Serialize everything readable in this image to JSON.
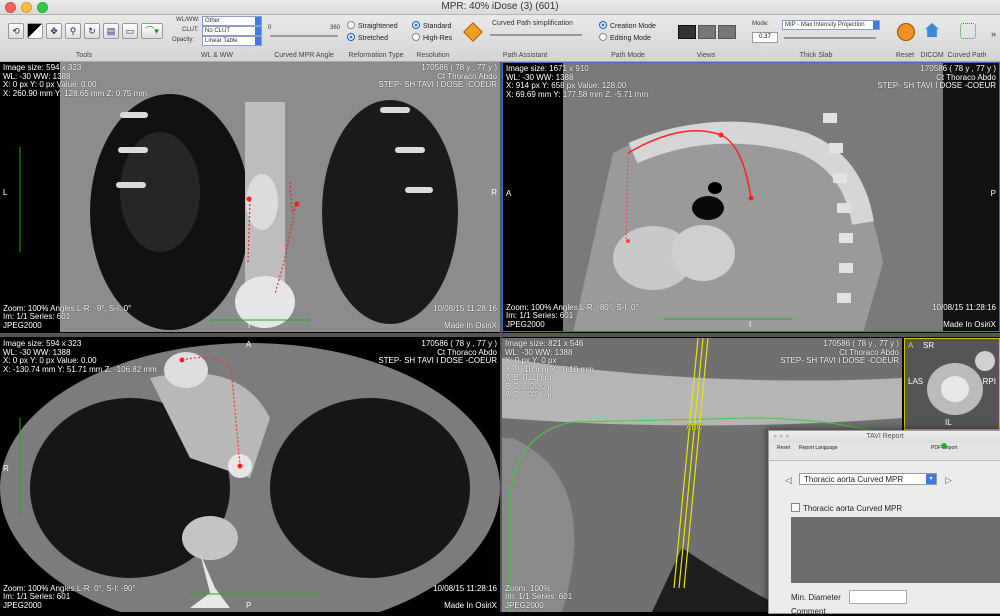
{
  "window": {
    "title": "MPR: 40% iDose (3) (601)"
  },
  "toolbar": {
    "groups": {
      "tools": "Tools",
      "wlww": "WL & WW",
      "curved_angle": "Curved MPR Angle",
      "reformation": "Reformation Type",
      "resolution": "Resolution",
      "path_assistant": "Path Assistant",
      "path_mode": "Path Mode",
      "views": "Views",
      "thick_slab": "Thick Slab",
      "reset": "Reset",
      "dicom": "DICOM",
      "curved_path": "Curved Path"
    },
    "wlww": {
      "wl_label": "WL/WW:",
      "wl_value": "Other",
      "clut_label": "CLUT:",
      "clut_value": "No CLUT",
      "opacity_label": "Opacity:",
      "opacity_value": "Linear Table"
    },
    "angle": {
      "min": "0",
      "max": "360"
    },
    "reformation": {
      "straightened": "Straightened",
      "stretched": "Stretched",
      "selected": "stretched"
    },
    "resolution": {
      "standard": "Standard",
      "high": "High-Res",
      "selected": "standard"
    },
    "path_assistant": {
      "label": "Curved Path simplification"
    },
    "path_mode": {
      "creation": "Creation Mode",
      "editing": "Editing Mode",
      "selected": "creation"
    },
    "thick_slab": {
      "mode_label": "Mode:",
      "mode_value": "MIP - Max Intensity Projection",
      "value": "0.37"
    }
  },
  "viewports": {
    "coronal": {
      "tl": [
        "Image size: 594 x 323",
        "WL: -30 WW: 1388",
        "X: 0 px Y: 0 px Value: 0.00",
        "X: 260.90 mm Y: 128.65 mm Z: 0.75 mm"
      ],
      "tr": [
        "170586 ( 78 y , 77 y )",
        "Ct Thoraco Abdo",
        "STEP- SH TAVI I DOSE -COEUR"
      ],
      "bl": [
        "Zoom: 100% Angles L-R: -9°, S-I: 0°",
        "Im: 1/1  Series: 601",
        "JPEG2000"
      ],
      "br": [
        "10/08/15 11:28:16",
        "",
        "Made In OsiriX"
      ],
      "left": "L",
      "right": "R",
      "bottom": "I"
    },
    "sagittal": {
      "tl": [
        "Image size: 1671 x 910",
        "WL: -30 WW: 1388",
        "X: 914 px Y: 658 px Value: 128.00",
        "X: 69.69 mm Y: 177.58 mm Z: -5.71 mm"
      ],
      "tr": [
        "170586 ( 78 y , 77 y )",
        "Ct Thoraco Abdo",
        "STEP- SH TAVI I DOSE -COEUR"
      ],
      "bl": [
        "Zoom: 100% Angles L-R: -80°, S-I: 0°",
        "Im: 1/1  Series: 601",
        "JPEG2000"
      ],
      "br": [
        "10/08/15 11:28:16",
        "",
        "Made In OsiriX"
      ],
      "left": "A",
      "right": "P",
      "bottom": "I"
    },
    "axial": {
      "tl": [
        "Image size: 594 x 323",
        "WL: -30 WW: 1388",
        "X: 0 px Y: 0 px Value: 0.00",
        "X: -130.74 mm Y: 51.71 mm Z: -106.82 mm"
      ],
      "tr": [
        "170586 ( 78 y , 77 y )",
        "Ct Thoraco Abdo",
        "STEP- SH TAVI I DOSE -COEUR"
      ],
      "bl": [
        "Zoom: 100% Angles L-R: 0°, S-I: -90°",
        "Im: 1/1  Series: 601",
        "JPEG2000"
      ],
      "br": [
        "10/08/15 11:28:16",
        "",
        "Made In OsiriX"
      ],
      "left": "R",
      "top": "A",
      "bottom": "P"
    },
    "curved": {
      "tl": [
        "Image size: 821 x 546",
        "WL: -30 WW: 1388",
        "X: 0 px Y: 0 px",
        "X: -0.10 mm Y: -0.10 mm",
        "A-B: 0.20 cm",
        "B-C: 0.20 cm",
        "A-C: 0.40 cm"
      ],
      "tr": [
        "170586 ( 78 y , 77 y )",
        "Ct Thoraco Abdo",
        "STEP- SH TAVI I DOSE -COEUR"
      ],
      "bl": [
        "Zoom: 100%",
        "Im: 1/1  Series: 601",
        "JPEG2000"
      ],
      "marker": "ABC"
    },
    "thumb": {
      "labels": [
        "A",
        "SR",
        "LAS",
        "RPI",
        "IL"
      ]
    }
  },
  "tavi": {
    "title": "TAVI Report",
    "reset": "Reset",
    "language": "Report Language",
    "pdf": "PDF Report",
    "dropdown": "Thoracic aorta Curved MPR",
    "checkbox": "Thoracic aorta Curved MPR",
    "min_diameter": "Min. Diameter",
    "comment": "Comment"
  }
}
